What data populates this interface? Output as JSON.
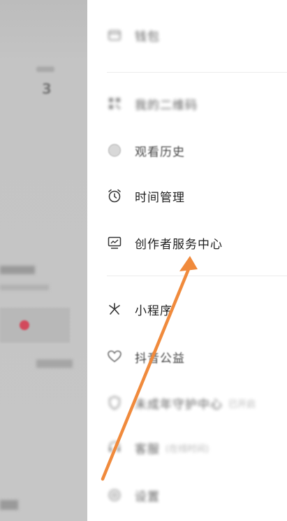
{
  "background_page": {
    "count_value": "3"
  },
  "drawer": {
    "items": [
      {
        "label": "钱包",
        "icon": "wallet-icon",
        "style": "blurred"
      },
      {
        "label": "我的二维码",
        "icon": "qrcode-icon",
        "style": "blurred"
      },
      {
        "label": "观看历史",
        "icon": "history-icon",
        "style": "semi"
      },
      {
        "label": "时间管理",
        "icon": "alarm-clock-icon",
        "style": "clear"
      },
      {
        "label": "创作者服务中心",
        "icon": "creator-center-icon",
        "style": "clear"
      },
      {
        "label": "小程序",
        "icon": "mini-program-icon",
        "style": "clear"
      },
      {
        "label": "抖音公益",
        "icon": "charity-heart-icon",
        "style": "semi"
      },
      {
        "label": "未成年守护中心",
        "suffix": "已开启",
        "icon": "youth-shield-icon",
        "style": "blurred"
      },
      {
        "label": "客服",
        "suffix": "(在线时间)",
        "icon": "customer-service-icon",
        "style": "blurred"
      },
      {
        "label": "设置",
        "icon": "settings-icon",
        "style": "blurred"
      }
    ]
  },
  "annotation": {
    "color": "#f08a3c",
    "description_icon": "arrow-annotation-icon"
  }
}
